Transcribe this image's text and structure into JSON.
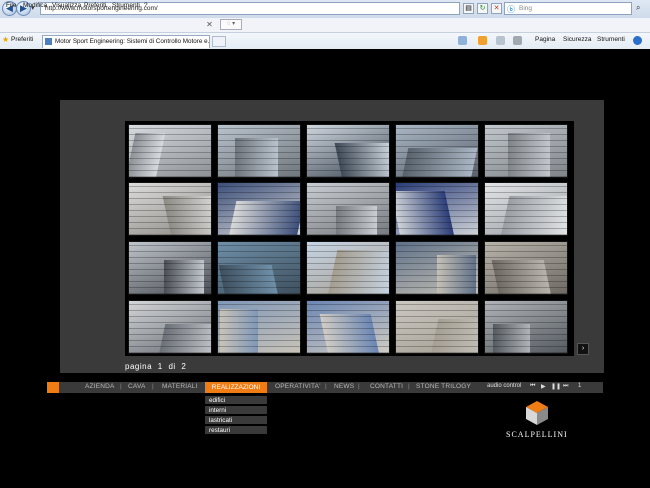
{
  "browser": {
    "url": "http://www.motorsportengineering.com/",
    "search_placeholder": "Bing",
    "search_engine": "Bing",
    "menu": [
      "File",
      "Modifica",
      "Visualizza",
      "Preferiti",
      "Strumenti",
      "?"
    ],
    "favorites_label": "Preferiti",
    "tab_title": "Motor Sport Engineering: Sistemi di Controllo Motore e...",
    "commands": [
      "Pagina",
      "Sicurezza",
      "Strumenti"
    ]
  },
  "gallery": {
    "pager_label": "pagina",
    "current_page": "1",
    "of_label": "di",
    "total_pages": "2",
    "next_label": "›"
  },
  "nav": {
    "items": [
      "AZIENDA",
      "CAVA",
      "MATERIALI",
      "REALIZZAZIONI",
      "OPERATIVITA'",
      "NEWS",
      "CONTATTI",
      "STONE TRILOGY"
    ],
    "active": "REALIZZAZIONI",
    "audio_label": "audio control",
    "audio_track": "1"
  },
  "submenu": {
    "items": [
      "edifici",
      "interni",
      "lastricati",
      "restauri"
    ]
  },
  "brand": {
    "name": "SCALPELLINI",
    "accent": "#f07c16"
  }
}
